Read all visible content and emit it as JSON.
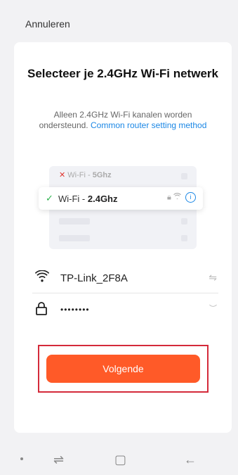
{
  "header": {
    "cancel_label": "Annuleren"
  },
  "card": {
    "title": "Selecteer je 2.4GHz Wi-Fi netwerk",
    "subtitle_text": "Alleen 2.4GHz Wi-Fi kanalen worden ondersteund.",
    "subtitle_link": "Common router setting method"
  },
  "illustration": {
    "row_5g_prefix": "Wi-Fi - ",
    "row_5g_band": "5Ghz",
    "row_24_prefix": "Wi-Fi - ",
    "row_24_band": "2.4Ghz",
    "info_symbol": "i"
  },
  "form": {
    "ssid_value": "TP-Link_2F8A",
    "password_value": "••••••••"
  },
  "actions": {
    "next_label": "Volgende"
  },
  "colors": {
    "accent": "#ff5a28",
    "link": "#1b87e5",
    "highlight_border": "#d42a3a"
  }
}
